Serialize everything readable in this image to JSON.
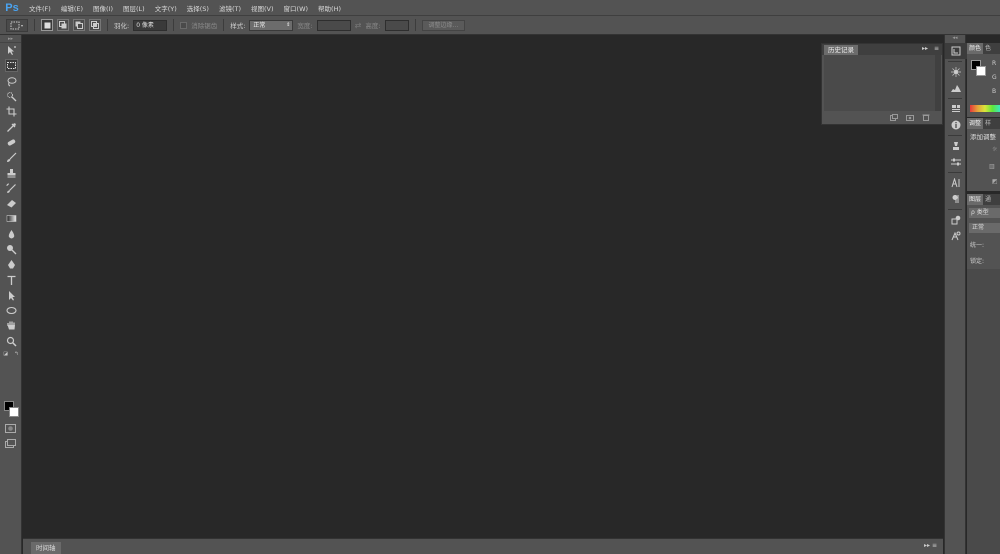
{
  "app": {
    "logo": "Ps"
  },
  "menu": [
    "文件(F)",
    "编辑(E)",
    "图像(I)",
    "图层(L)",
    "文字(Y)",
    "选择(S)",
    "滤镜(T)",
    "视图(V)",
    "窗口(W)",
    "帮助(H)"
  ],
  "options": {
    "feather_label": "羽化:",
    "feather_value": "0 像素",
    "antialias_label": "消除锯齿",
    "style_label": "样式:",
    "style_value": "正常",
    "width_label": "宽度:",
    "height_label": "高度:",
    "refine_button": "调整边缘..."
  },
  "history_panel": {
    "title": "历史记录"
  },
  "timeline": {
    "tab": "时间轴"
  },
  "right_panels": {
    "color_tab": "颜色",
    "color_tab2": "色",
    "r_label": "R",
    "g_label": "G",
    "b_label": "B",
    "adjust_tab": "调整",
    "adjust_tab2": "样",
    "adjust_hint": "添加调整",
    "layers_tab": "图层",
    "layers_tab2": "通",
    "layers_filter": "ρ 类型",
    "blend_mode": "正常",
    "lock_label": "锁定:",
    "unify_label": "统一:"
  },
  "swatch_colors": {
    "foreground": "#000000",
    "background": "#ffffff"
  }
}
